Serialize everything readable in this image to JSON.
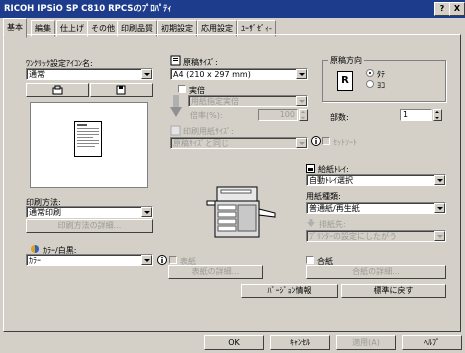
{
  "window": {
    "title": "RICOH IPSiO SP C810 RPCSのﾌﾟﾛﾊﾟﾃｨ",
    "help_btn": "?",
    "close_btn": "X"
  },
  "tabs": [
    "基本",
    "編集",
    "仕上げ",
    "その他",
    "印刷品質",
    "初期設定",
    "応用設定",
    "ﾕｰｻﾞｾﾞｨ-"
  ],
  "one_click": {
    "label": "ﾜﾝｸﾘｯｸ設定ｱｲｺﾝ名:",
    "value": "通常"
  },
  "paper_size": {
    "label": "原稿ｻｲｽﾞ:",
    "value": "A4 (210 x 297 mm)"
  },
  "actual_size": {
    "label": "実倍",
    "dropdown": "用紙指定実倍",
    "scale_label": "倍率(%):",
    "scale_value": "100"
  },
  "print_paper_size": {
    "label": "印刷用紙ｻｲｽﾞ:",
    "value": "原稿ｻｲｽﾞと同じ"
  },
  "orientation": {
    "label": "原稿方向",
    "portrait": "ﾀﾃ",
    "landscape": "ﾖｺ",
    "icon_letter": "R"
  },
  "copies": {
    "label": "部数:",
    "value": "1"
  },
  "collate": {
    "label": "ｾｯﾄｿｰﾄ"
  },
  "tray": {
    "label": "給紙ﾄﾚｲ:",
    "value": "自動ﾄﾚｲ選択"
  },
  "paper_type": {
    "label": "用紙種類:",
    "value": "普通紙/再生紙"
  },
  "output": {
    "label": "排紙先:",
    "value": "ﾌﾟﾘﾝﾀｰの設定にしたがう"
  },
  "print_method": {
    "label": "印刷方法:",
    "value": "通常印刷",
    "detail": "印刷方法の詳細..."
  },
  "color": {
    "label": "ｶﾗｰ/白黒:",
    "value": "ｶﾗｰ"
  },
  "cover": {
    "label": "表紙",
    "detail": "表紙の詳細..."
  },
  "slip": {
    "label": "合紙",
    "detail": "合紙の詳細..."
  },
  "version_btn": "ﾊﾞｰｼﾞｮﾝ情報",
  "default_btn": "標準に戻す",
  "footer": {
    "ok": "OK",
    "cancel": "ｷｬﾝｾﾙ",
    "apply": "適用(A)",
    "help": "ﾍﾙﾌﾟ"
  }
}
